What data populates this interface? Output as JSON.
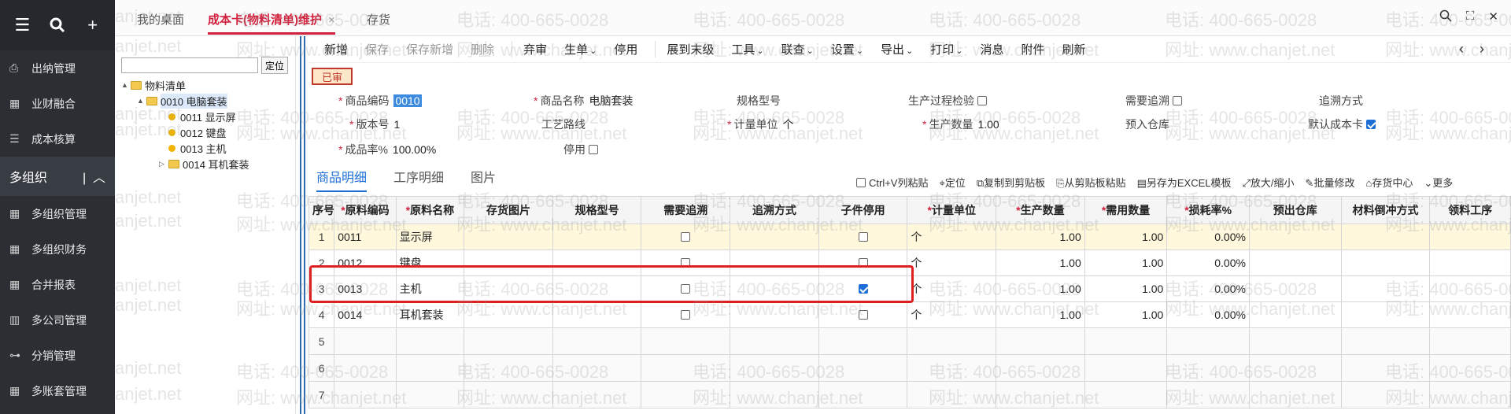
{
  "sidebar": {
    "top_icons": [
      "menu-icon",
      "search-icon",
      "plus-icon"
    ],
    "items_a": [
      {
        "label": "出纳管理",
        "icon": "cash-icon"
      },
      {
        "label": "业财融合",
        "icon": "grid-icon"
      },
      {
        "label": "成本核算",
        "icon": "list-icon"
      }
    ],
    "group": {
      "label": "多组织",
      "icon": "chevron-up-icon"
    },
    "items_b": [
      {
        "label": "多组织管理",
        "icon": "grid-icon"
      },
      {
        "label": "多组织财务",
        "icon": "grid-icon"
      },
      {
        "label": "合并报表",
        "icon": "grid-icon"
      },
      {
        "label": "多公司管理",
        "icon": "building-icon"
      },
      {
        "label": "分销管理",
        "icon": "org-icon"
      },
      {
        "label": "多账套管理",
        "icon": "grid-icon"
      }
    ]
  },
  "tabs": [
    {
      "label": "我的桌面"
    },
    {
      "label": "成本卡(物料清单)维护",
      "close": "×"
    },
    {
      "label": "存货"
    }
  ],
  "tree": {
    "locate_label": "定位",
    "search_value": "",
    "nodes": [
      {
        "label": "物料清单"
      },
      {
        "label": "0010 电脑套装"
      },
      {
        "label": "0011 显示屏"
      },
      {
        "label": "0012 键盘"
      },
      {
        "label": "0013 主机"
      },
      {
        "label": "0014 耳机套装"
      }
    ]
  },
  "toolbar": {
    "buttons": [
      "新增",
      "保存",
      "保存新增",
      "删除",
      "弃审",
      "生单",
      "停用",
      "展到末级",
      "工具",
      "联查",
      "设置",
      "导出",
      "打印",
      "消息",
      "附件",
      "刷新"
    ]
  },
  "status": "已审",
  "form": {
    "code_label": "商品编码",
    "code_value": "0010",
    "name_label": "商品名称",
    "name_value": "电脑套装",
    "spec_label": "规格型号",
    "qc_label": "生产过程检验",
    "trace_label": "需要追溯",
    "trace_method_label": "追溯方式",
    "version_label": "版本号",
    "version_value": "1",
    "route_label": "工艺路线",
    "unit_label": "计量单位",
    "unit_value": "个",
    "qty_label": "生产数量",
    "qty_value": "1.00",
    "warehouse_label": "预入仓库",
    "default_card_label": "默认成本卡",
    "yield_label": "成品率%",
    "yield_value": "100.00%",
    "disabled_label": "停用"
  },
  "subtabs": [
    "商品明细",
    "工序明细",
    "图片"
  ],
  "grid_tools": [
    "Ctrl+V列粘贴",
    "定位",
    "复制到剪贴板",
    "从剪贴板粘贴",
    "另存为EXCEL模板",
    "放大/缩小",
    "批量修改",
    "存货中心",
    "更多"
  ],
  "grid": {
    "headers": [
      "序号",
      "原料编码",
      "原料名称",
      "存货图片",
      "规格型号",
      "需要追溯",
      "追溯方式",
      "子件停用",
      "计量单位",
      "生产数量",
      "需用数量",
      "损耗率%",
      "预出仓库",
      "材料倒冲方式",
      "领料工序"
    ],
    "rows": [
      {
        "seq": "1",
        "code": "0011",
        "name": "显示屏",
        "trace": false,
        "stop": false,
        "unit": "个",
        "qty": "1.00",
        "need": "1.00",
        "loss": "0.00%"
      },
      {
        "seq": "2",
        "code": "0012",
        "name": "键盘",
        "trace": false,
        "stop": false,
        "unit": "个",
        "qty": "1.00",
        "need": "1.00",
        "loss": "0.00%"
      },
      {
        "seq": "3",
        "code": "0013",
        "name": "主机",
        "trace": false,
        "stop": true,
        "unit": "个",
        "qty": "1.00",
        "need": "1.00",
        "loss": "0.00%"
      },
      {
        "seq": "4",
        "code": "0014",
        "name": "耳机套装",
        "trace": false,
        "stop": false,
        "unit": "个",
        "qty": "1.00",
        "need": "1.00",
        "loss": "0.00%"
      }
    ],
    "empty_rows": [
      "5",
      "6",
      "7"
    ]
  },
  "watermark": {
    "phone": "电话: 400-665-0028",
    "site": "网址: www.chanjet.net",
    "short_site": "anjet.net"
  },
  "colors": {
    "sidebar": "#2b2f34",
    "accent": "#d21f3c",
    "link": "#1b6fd6",
    "highlight_box": "#e02020"
  }
}
